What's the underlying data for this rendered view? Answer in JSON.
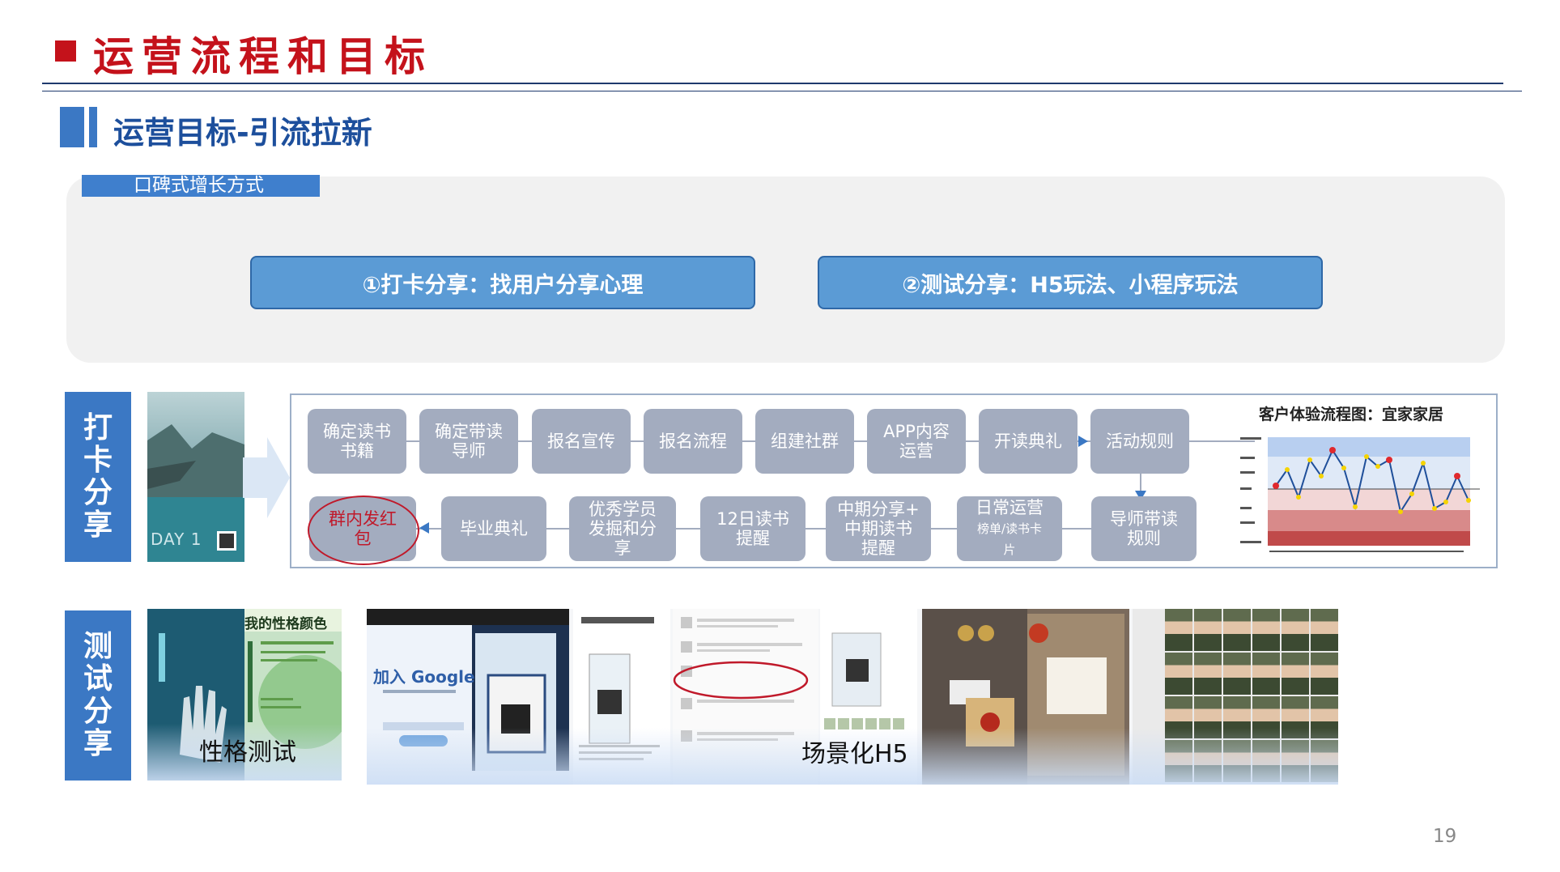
{
  "title": "运营流程和目标",
  "subtitle": "运营目标-引流拉新",
  "panel": {
    "tag": "口碑式增长方式",
    "option1": "①打卡分享：找用户分享心理",
    "option2": "②测试分享：H5玩法、小程序玩法"
  },
  "checkin": {
    "label": [
      "打",
      "卡",
      "分",
      "享"
    ],
    "photo_caption": "DAY 1",
    "flow_top": [
      {
        "l1": "确定读书",
        "l2": "书籍"
      },
      {
        "l1": "确定带读",
        "l2": "导师"
      },
      {
        "l1": "报名宣传",
        "l2": ""
      },
      {
        "l1": "报名流程",
        "l2": ""
      },
      {
        "l1": "组建社群",
        "l2": ""
      },
      {
        "l1": "APP内容",
        "l2": "运营"
      },
      {
        "l1": "开读典礼",
        "l2": ""
      },
      {
        "l1": "活动规则",
        "l2": ""
      }
    ],
    "flow_bottom_right": {
      "l1": "导师带读",
      "l2": "规则"
    },
    "flow_bottom": [
      {
        "l1": "日常运营",
        "l2": "榜单/读书卡",
        "l3": "片"
      },
      {
        "l1": "中期分享+",
        "l2": "中期读书",
        "l3": "提醒"
      },
      {
        "l1": "12日读书",
        "l2": "提醒",
        "l3": ""
      },
      {
        "l1": "优秀学员",
        "l2": "发掘和分",
        "l3": "享"
      },
      {
        "l1": "毕业典礼",
        "l2": "",
        "l3": ""
      }
    ],
    "flow_highlight": {
      "l1": "群内发红",
      "l2": "包"
    },
    "cx_map_title": "客户体验流程图：宜家家居"
  },
  "test": {
    "label": [
      "测",
      "试",
      "分",
      "享"
    ],
    "personality_title": "我的性格颜色",
    "personality_caption": "性格测试",
    "h5_caption": "场景化H5",
    "google_text": "加入 Google"
  },
  "page_number": "19",
  "colors": {
    "title_red": "#c4121b",
    "accent_blue": "#3b78c4",
    "pill_blue": "#5b9bd5",
    "flow_gray": "#a3acbf"
  }
}
